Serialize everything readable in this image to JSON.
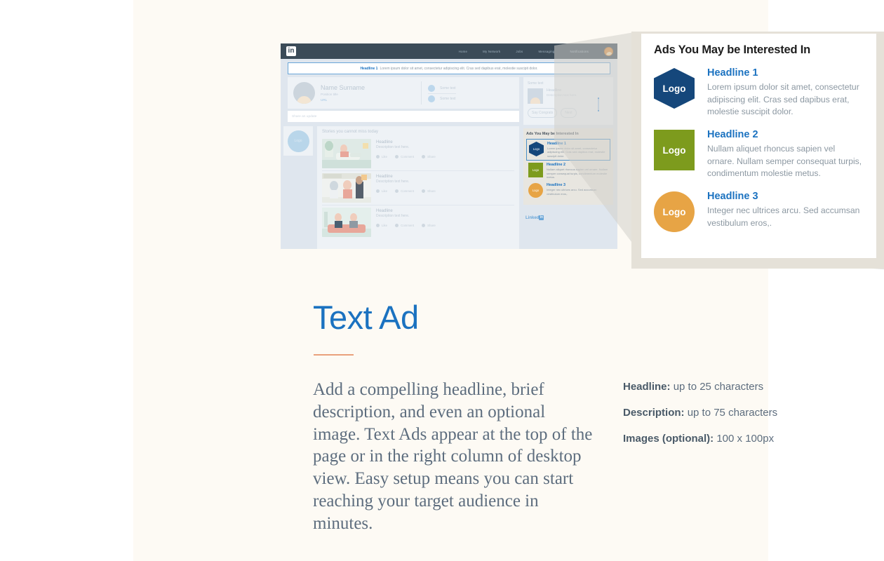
{
  "colors": {
    "page_bg": "#fdfaf4",
    "accent_blue": "#1b72c0",
    "accent_orange": "#e9a07c",
    "logo_hex": "#15477b",
    "logo_square": "#7d9b1d",
    "logo_circle": "#e7a445",
    "body_text": "#5d6d7e",
    "nav_bar": "#3b4b58"
  },
  "mockup": {
    "logo_text": "in",
    "nav_items": [
      {
        "label": "Home"
      },
      {
        "label": "My Network"
      },
      {
        "label": "Jobs"
      },
      {
        "label": "Messaging"
      },
      {
        "label": "Notifications"
      }
    ],
    "banner": {
      "headline": "Headline 1",
      "text": "Lorem ipsum dolor sit amet, consectetur adipiscing elit. Cras sed dapibus erat, molestie suscipit dolor."
    },
    "profile": {
      "name": "Name Surname",
      "position": "Position title",
      "url": "URL",
      "rows": [
        {
          "label": "Some text"
        },
        {
          "label": "Some text"
        }
      ]
    },
    "share_placeholder": "Share an update",
    "left_logo_label": "Logo",
    "feed": {
      "title": "Stories you cannot miss today",
      "cards": [
        {
          "headline": "Headline",
          "description": "Description text here.",
          "actions": [
            "Like",
            "Comment",
            "Share"
          ]
        },
        {
          "headline": "Headline",
          "description": "Description text here.",
          "actions": [
            "Like",
            "Comment",
            "Share"
          ]
        },
        {
          "headline": "Headline",
          "description": "Description text here.",
          "actions": [
            "Like",
            "Comment",
            "Share"
          ]
        }
      ]
    },
    "right_card": {
      "some_text": "Some text",
      "headline": "Headline",
      "description": "Description text here.",
      "primary_button": "Say Congrats",
      "secondary_button": "Next"
    },
    "ads_box": {
      "title": "Ads You May be Interested In",
      "ads": [
        {
          "logo_label": "Logo",
          "headline": "Headline 1",
          "description": "Lorem ipsum dolor sit amet, consectetur adipiscing elit. Cras sed dapibus erat, molestie suscipit dolor."
        },
        {
          "logo_label": "Logo",
          "headline": "Headline 2",
          "description": "Nullam aliquet rhoncus sapien vel ornare. Nullam semper consequat turpis, condimentum molestie metus."
        },
        {
          "logo_label": "Logo",
          "headline": "Headline 3",
          "description": "Integer nec ultrices arcu. Sed accumsan vestibulum eros,."
        }
      ]
    },
    "footer_brand": "Linked",
    "footer_brand_icon": "in"
  },
  "panel": {
    "title": "Ads You May be Interested In",
    "ads": [
      {
        "logo_label": "Logo",
        "headline": "Headline 1",
        "description": "Lorem ipsum dolor sit amet, consectetur adipiscing elit. Cras sed dapibus erat, molestie suscipit dolor."
      },
      {
        "logo_label": "Logo",
        "headline": "Headline 2",
        "description": "Nullam aliquet rhoncus sapien vel ornare. Nullam semper consequat turpis, condimentum molestie metus."
      },
      {
        "logo_label": "Logo",
        "headline": "Headline 3",
        "description": "Integer nec ultrices arcu. Sed accumsan vestibulum eros,."
      }
    ]
  },
  "content": {
    "heading": "Text Ad",
    "body": "Add a compelling headline, brief description, and even an optional image. Text Ads appear at the top of the page or in the right column of desktop view. Easy setup means you can start reaching your target audience in minutes.",
    "specs": [
      {
        "label": "Headline:",
        "value": "up to 25 characters"
      },
      {
        "label": "Description:",
        "value": "up to 75 characters"
      },
      {
        "label": "Images (optional):",
        "value": "100 x 100px"
      }
    ]
  }
}
